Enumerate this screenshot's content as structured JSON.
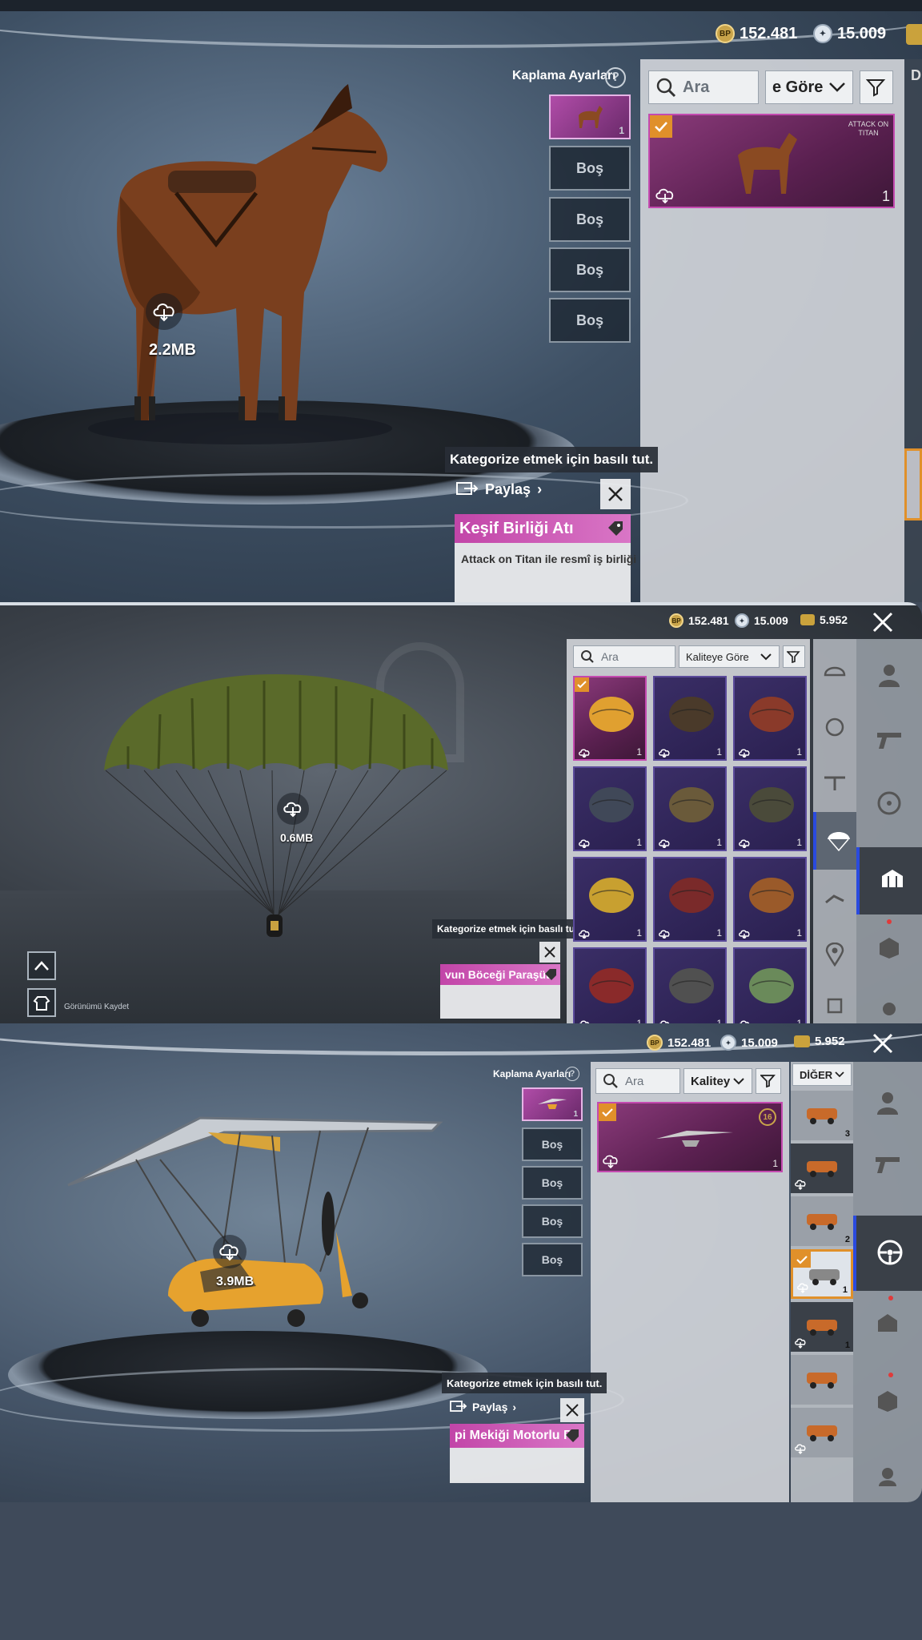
{
  "shot1": {
    "currency": {
      "bp": "152.481",
      "uc": "15.009"
    },
    "bp_icon": "BP",
    "skin_settings": "Kaplama Ayarları",
    "help_icon": "?",
    "slots": [
      "1",
      "Boş",
      "Boş",
      "Boş",
      "Boş"
    ],
    "download_size": "2.2MB",
    "search_placeholder": "Ara",
    "sort_label": "e Göre",
    "item_count": "1",
    "tooltip": "Kategorize etmek için basılı tut.",
    "share": "Paylaş",
    "item_name": "Keşif Birliği Atı",
    "item_desc": "Attack on Titan ile resmî iş birliği",
    "edge_letter": "D"
  },
  "shot2": {
    "currency": {
      "bp": "152.481",
      "uc": "15.009",
      "ag": "5.952"
    },
    "bp_icon": "BP",
    "download_size": "0.6MB",
    "search_placeholder": "Ara",
    "sort_label": "Kaliteye Göre",
    "grid_counts": [
      "1",
      "1",
      "1",
      "1",
      "1",
      "1",
      "1",
      "1",
      "1",
      "1",
      "1",
      "1"
    ],
    "tooltip": "Kategorize etmek için basılı tut.",
    "item_name": "vun Böceği Paraşüt",
    "save_look": "Görünümü Kaydet"
  },
  "shot3": {
    "currency": {
      "bp": "152.481",
      "uc": "15.009",
      "ag": "5.952"
    },
    "bp_icon": "BP",
    "skin_settings": "Kaplama Ayarları",
    "help_icon": "?",
    "slots": [
      "1",
      "Boş",
      "Boş",
      "Boş",
      "Boş"
    ],
    "download_size": "3.9MB",
    "search_placeholder": "Ara",
    "sort_label": "Kalitey",
    "category": "DİĞER",
    "item_level": "16",
    "item_count": "1",
    "vehicle_counts": [
      "3",
      "",
      "2",
      "1",
      "1",
      "",
      ""
    ],
    "tooltip": "Kategorize etmek için basılı tut.",
    "share": "Paylaş",
    "item_name": "pi Mekiği Motorlu P"
  },
  "colors": {
    "accent": "#c245a8",
    "check": "#e0902a",
    "panel": "#d7dade",
    "selected_border": "#e6b4e6"
  },
  "icons": [
    "cloud-download-icon",
    "search-icon",
    "filter-icon",
    "chevron-down-icon",
    "close-icon",
    "tag-icon",
    "share-icon",
    "checkmark-icon",
    "gun-icon",
    "steering-wheel-icon",
    "parachute-icon",
    "helmet-icon",
    "backpack-icon",
    "location-icon",
    "chevron-up-icon"
  ]
}
